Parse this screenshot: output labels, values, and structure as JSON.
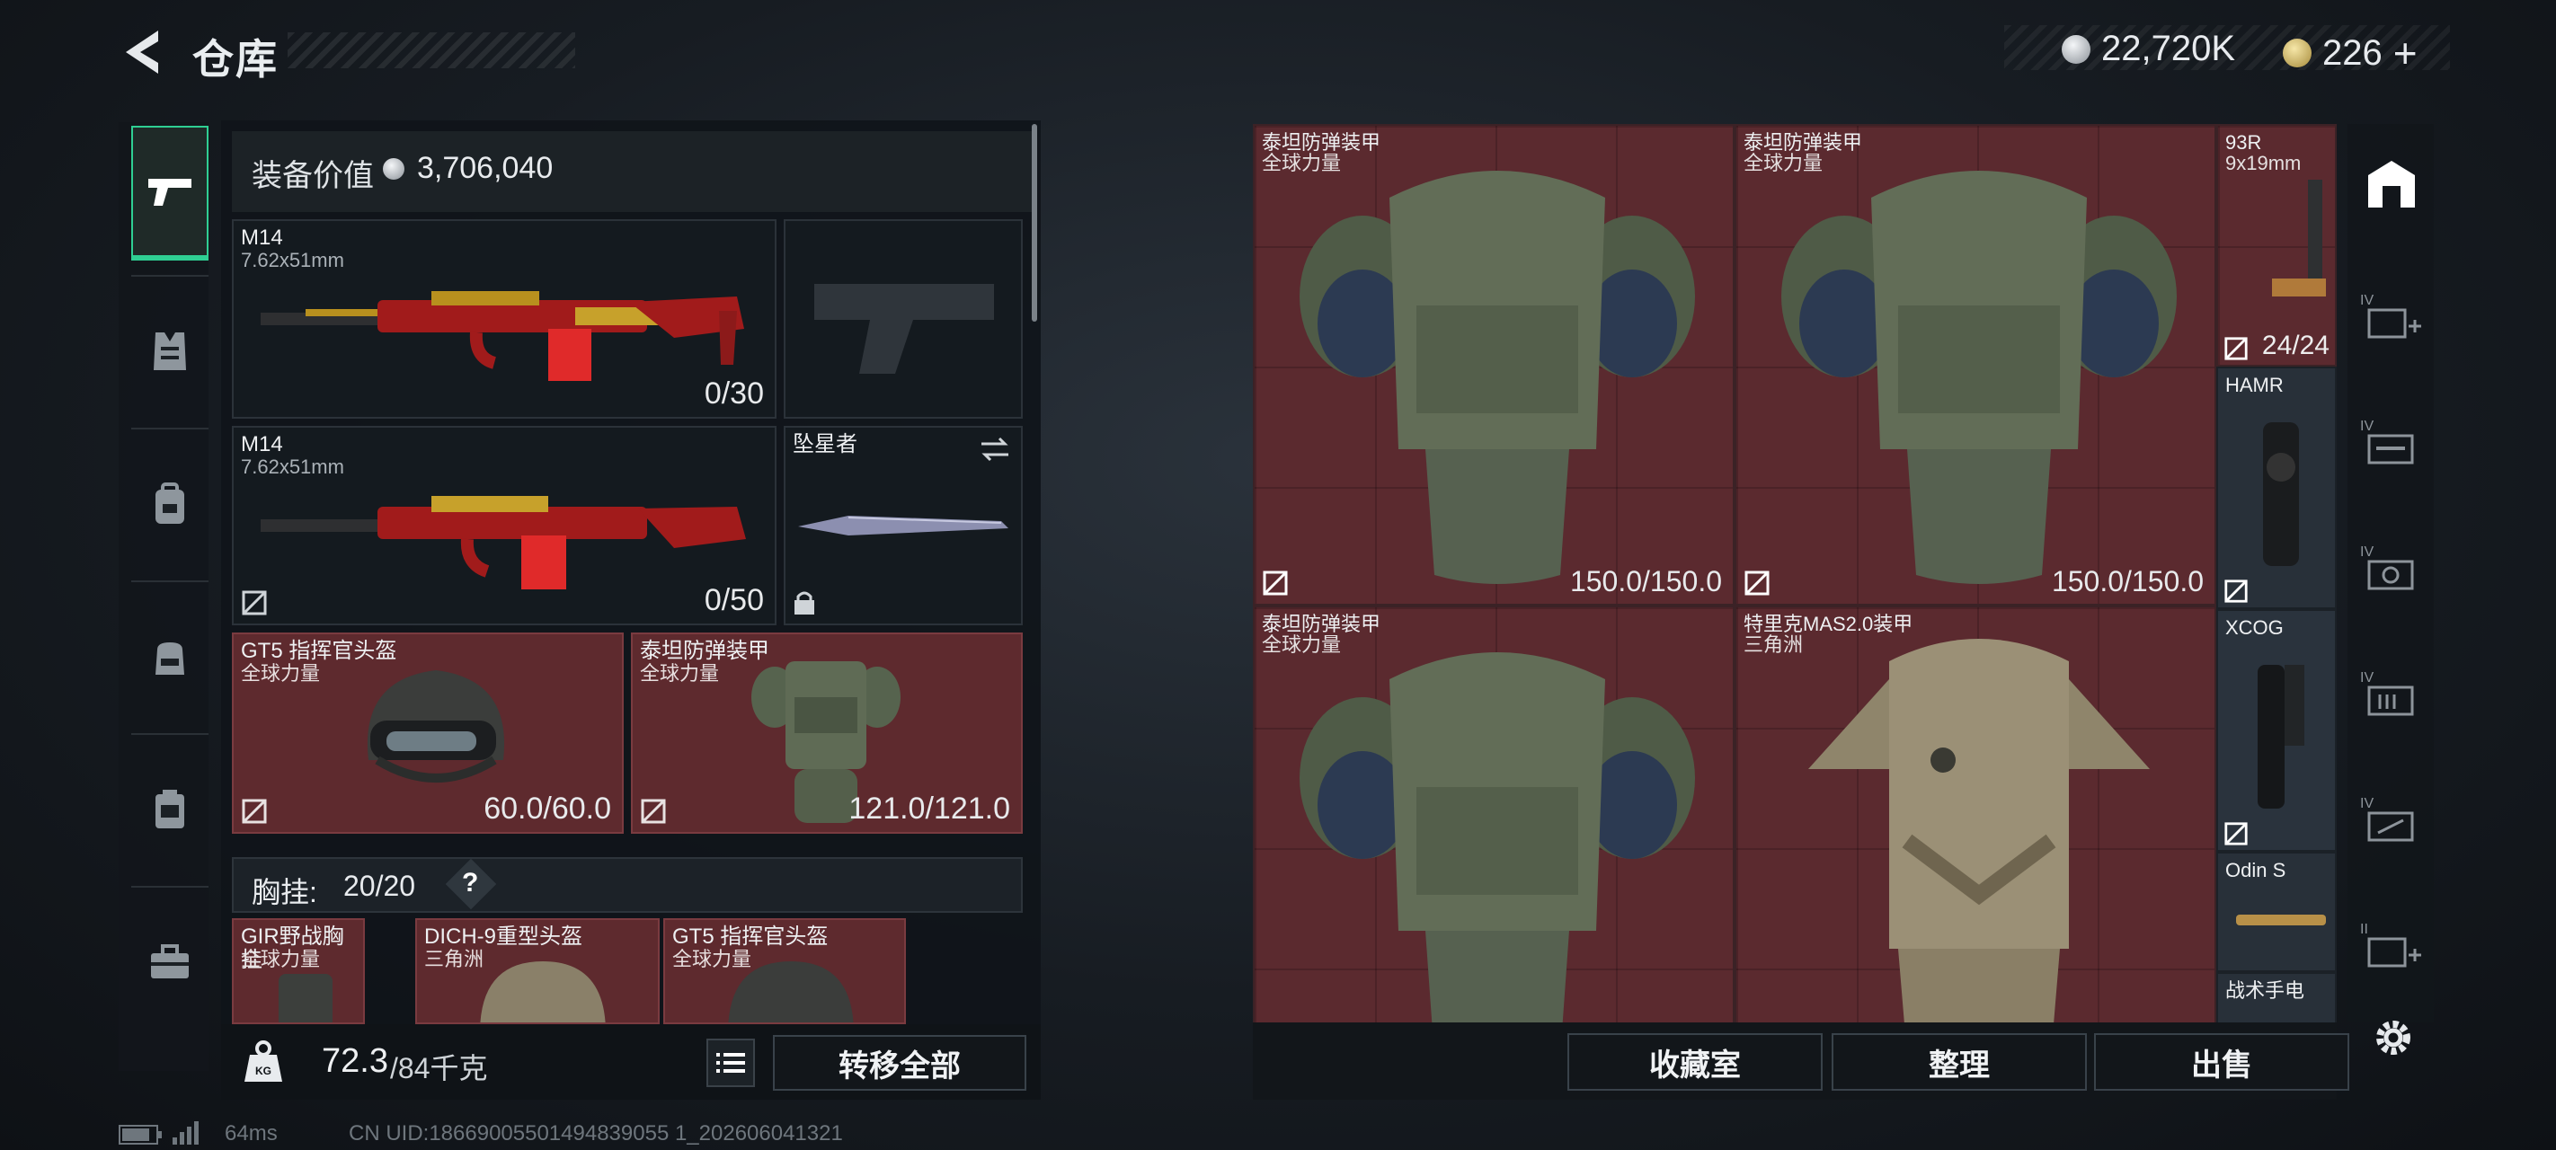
{
  "header": {
    "title": "仓库",
    "currency_silver": "22,720K",
    "currency_gold": "226",
    "add_symbol": "+"
  },
  "loadout": {
    "value_label": "装备价值",
    "value_amount": "3,706,040",
    "primary1": {
      "name": "M14",
      "caliber": "7.62x51mm",
      "count": "0/30"
    },
    "primary2": {
      "name": "M14",
      "caliber": "7.62x51mm",
      "count": "0/50"
    },
    "melee": {
      "name": "坠星者"
    },
    "helmet": {
      "name": "GT5 指挥官头盔",
      "sub": "全球力量",
      "count": "60.0/60.0"
    },
    "armor": {
      "name": "泰坦防弹装甲",
      "sub": "全球力量",
      "count": "121.0/121.0"
    },
    "rig_label": "胸挂:",
    "rig_capacity": "20/20",
    "rig_help": "?",
    "rig_items": [
      {
        "name": "GIR野战胸挂",
        "sub": "全球力量"
      },
      {
        "name": "DICH-9重型头盔",
        "sub": "三角洲"
      },
      {
        "name": "GT5 指挥官头盔",
        "sub": "全球力量"
      }
    ],
    "weight_current": "72.3",
    "weight_max": "/84千克",
    "transfer_all": "转移全部"
  },
  "stash": {
    "items": [
      {
        "name": "泰坦防弹装甲",
        "sub": "全球力量",
        "count": "150.0/150.0"
      },
      {
        "name": "泰坦防弹装甲",
        "sub": "全球力量",
        "count": "150.0/150.0"
      },
      {
        "name": "泰坦防弹装甲",
        "sub": "全球力量",
        "count": ""
      },
      {
        "name": "特里克MAS2.0装甲",
        "sub": "三角洲",
        "count": ""
      },
      {
        "name": "93R",
        "sub": "9x19mm",
        "count": "24/24"
      },
      {
        "name": "HAMR",
        "sub": "",
        "count": ""
      },
      {
        "name": "XCOG",
        "sub": "",
        "count": ""
      },
      {
        "name": "Odin S",
        "sub": "",
        "count": ""
      },
      {
        "name": "战术手电",
        "sub": "",
        "count": ""
      }
    ],
    "buttons": {
      "collection": "收藏室",
      "organize": "整理",
      "sell": "出售"
    }
  },
  "rail": {
    "tier_labels": [
      "IV",
      "IV",
      "IV",
      "IV",
      "IV",
      "II"
    ]
  },
  "footer": {
    "ping": "64ms",
    "uid": "CN UID:18669005501494839055 1_202606041321"
  },
  "colors": {
    "accent": "#2fcf93",
    "slot_red": "#5b2a2f",
    "panel": "#12161b"
  }
}
